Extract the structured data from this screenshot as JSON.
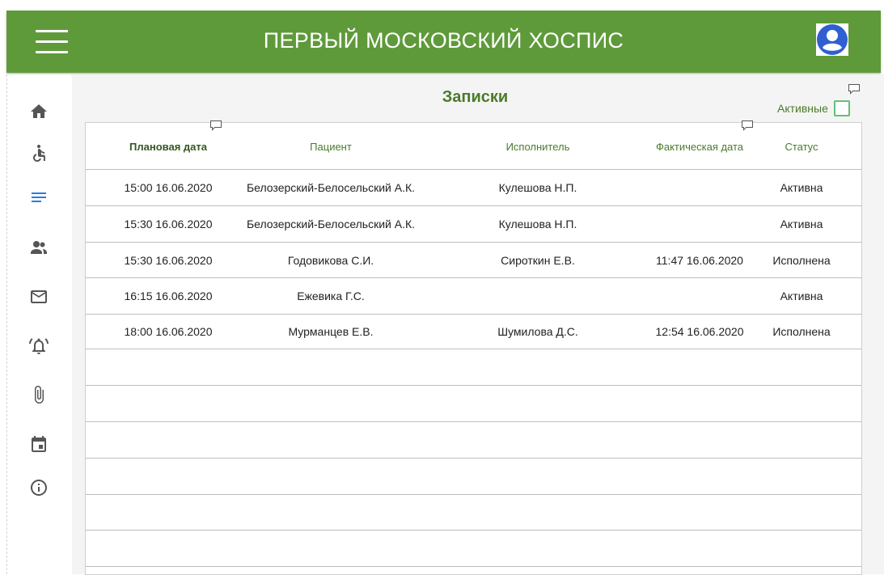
{
  "header": {
    "title": "ПЕРВЫЙ МОСКОВСКИЙ ХОСПИС"
  },
  "page": {
    "title": "Записки"
  },
  "filter": {
    "active_label": "Активные",
    "active_checked": false
  },
  "table": {
    "columns": [
      "Плановая дата",
      "Пациент",
      "Исполнитель",
      "Фактическая дата",
      "Статус"
    ],
    "rows": [
      [
        "15:00 16.06.2020",
        "Белозерский-Белосельский А.К.",
        "Кулешова Н.П.",
        "",
        "Активна"
      ],
      [
        "15:30 16.06.2020",
        "Белозерский-Белосельский А.К.",
        "Кулешова Н.П.",
        "",
        "Активна"
      ],
      [
        "15:30 16.06.2020",
        "Годовикова С.И.",
        "Сироткин Е.В.",
        "11:47 16.06.2020",
        "Исполнена"
      ],
      [
        "16:15 16.06.2020",
        "Ежевика Г.С.",
        "",
        "",
        "Активна"
      ],
      [
        "18:00 16.06.2020",
        "Мурманцев Е.В.",
        "Шумилова Д.С.",
        "12:54 16.06.2020",
        "Исполнена"
      ]
    ]
  },
  "sidebar": {
    "items": [
      {
        "icon": "home-icon"
      },
      {
        "icon": "wheelchair-icon"
      },
      {
        "icon": "notes-icon",
        "active": true
      },
      {
        "icon": "people-icon"
      },
      {
        "icon": "mail-icon"
      },
      {
        "icon": "alarm-icon"
      },
      {
        "icon": "attachment-icon"
      },
      {
        "icon": "calendar-icon"
      },
      {
        "icon": "info-icon"
      }
    ]
  },
  "colors": {
    "header_bg": "#5f9a3a",
    "accent_green": "#4b7a2a",
    "checkbox_border": "#63c07a",
    "nav_active": "#2b7de0",
    "nav_icon": "#555555",
    "avatar_blue": "#2f5fd0"
  }
}
